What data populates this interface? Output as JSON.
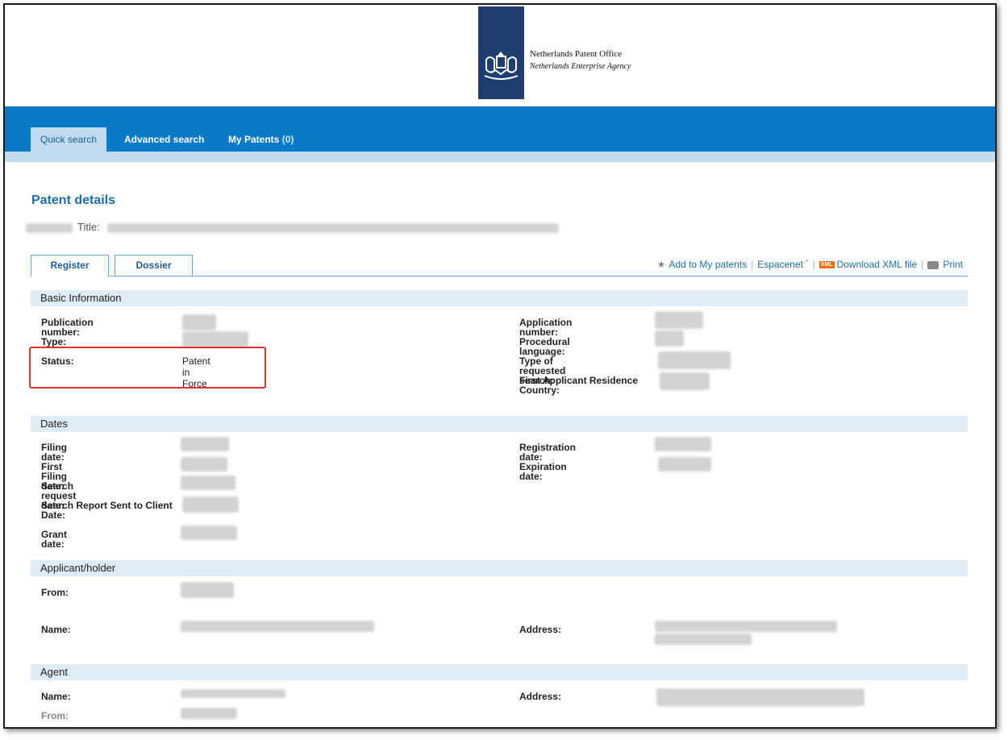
{
  "header": {
    "org_name": "Netherlands Patent Office",
    "org_sub": "Netherlands Enterprise Agency"
  },
  "nav": {
    "tabs": [
      {
        "label": "Quick search"
      },
      {
        "label": "Advanced search"
      },
      {
        "label": "My Patents",
        "count": "(0)"
      }
    ]
  },
  "page": {
    "title": "Patent details",
    "title_label": "Title:"
  },
  "subtabs": [
    "Register",
    "Dossier"
  ],
  "actions": {
    "add": "Add to My patents",
    "espacenet": "Espacenet",
    "xml_badge": "XML",
    "download": "Download XML file",
    "print": "Print"
  },
  "basic": {
    "heading": "Basic Information",
    "publication_number": "Publication number:",
    "type": "Type:",
    "status": "Status:",
    "status_value": "Patent in Force",
    "application_number": "Application number:",
    "procedural_language": "Procedural language:",
    "type_requested_search": "Type of requested search:",
    "first_applicant_country": "First Applicant Residence Country:"
  },
  "dates": {
    "heading": "Dates",
    "filing": "Filing date:",
    "first_filing": "First Filing date:",
    "search_request": "Search request date:",
    "search_report": "Search Report Sent to Client Date:",
    "grant": "Grant date:",
    "registration": "Registration date:",
    "expiration": "Expiration date:"
  },
  "applicant": {
    "heading": "Applicant/holder",
    "from": "From:",
    "name": "Name:",
    "address": "Address:"
  },
  "agent": {
    "heading": "Agent",
    "name": "Name:",
    "address": "Address:",
    "from": "From:"
  }
}
